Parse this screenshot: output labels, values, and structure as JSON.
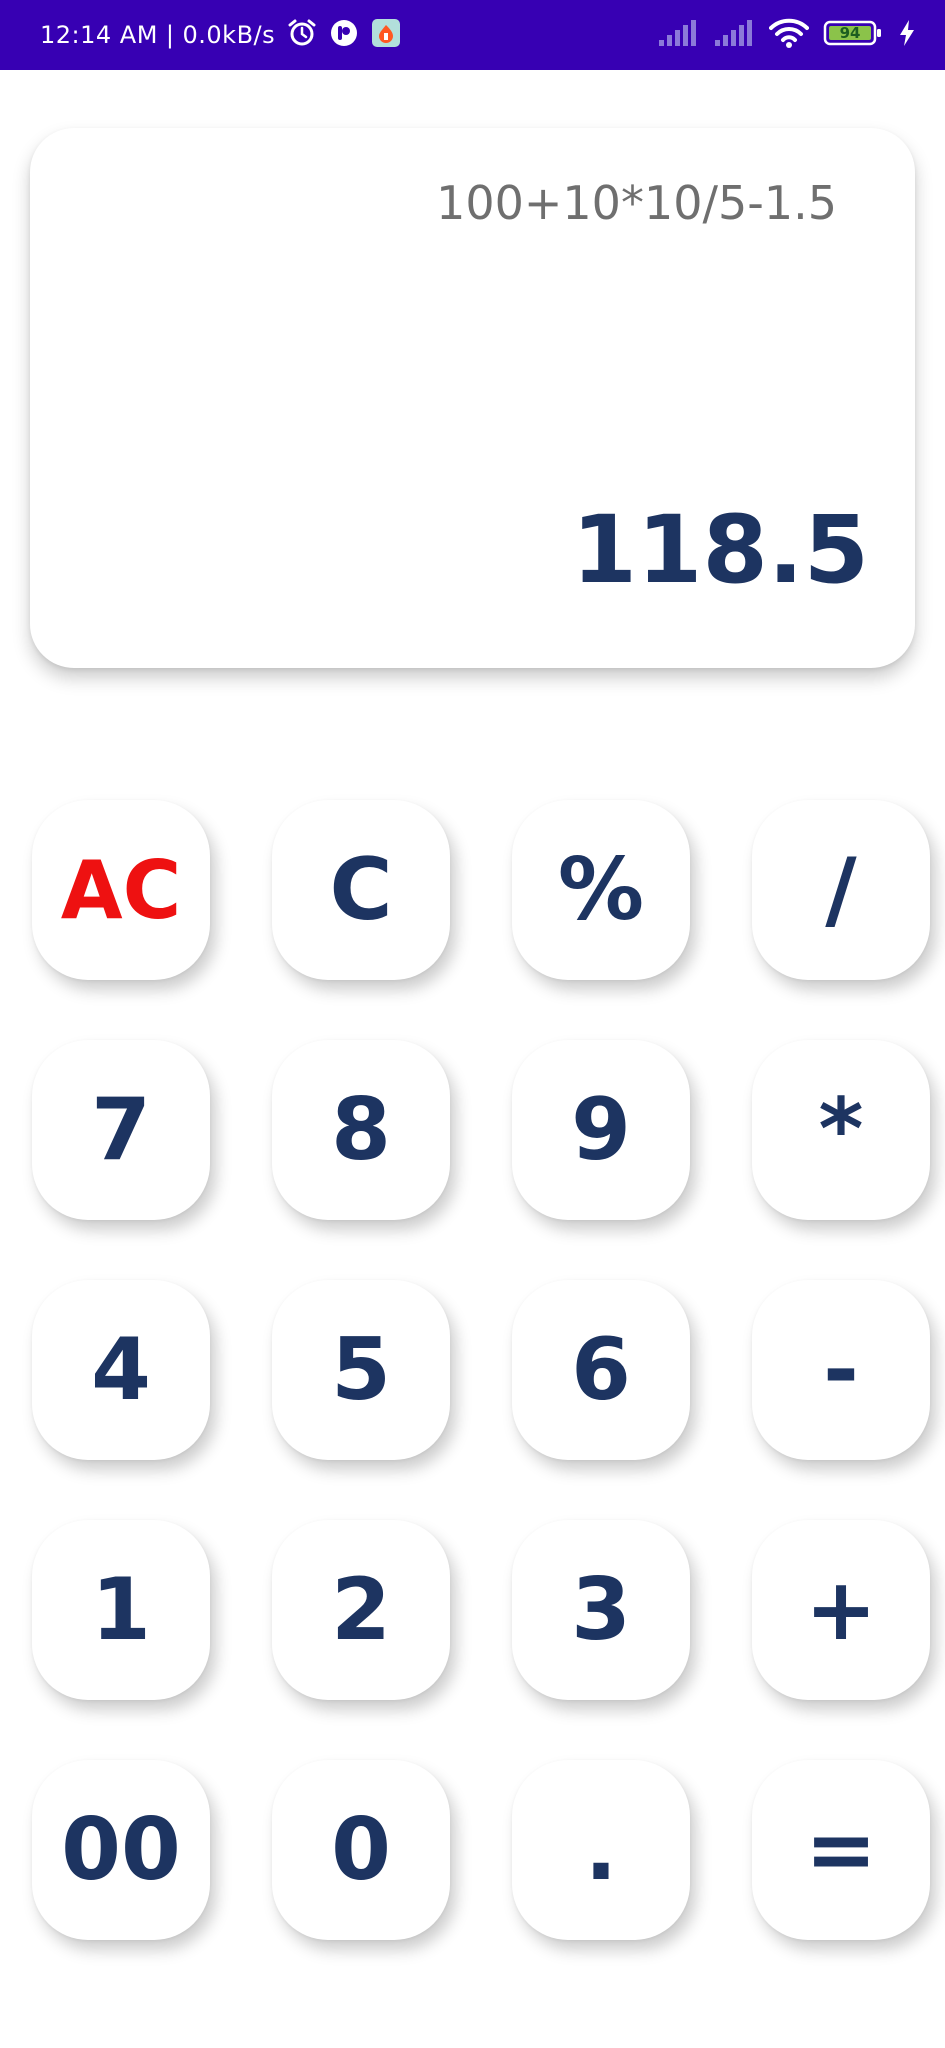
{
  "status_bar": {
    "time": "12:14 AM",
    "separator": "|",
    "speed": "0.0kB/s",
    "battery": "94",
    "icons": [
      "alarm-icon",
      "app-icon",
      "app-icon-orange",
      "signal-icon",
      "signal-icon",
      "wifi-icon",
      "battery-icon",
      "charging-icon"
    ]
  },
  "display": {
    "expression": "100+10*10/5-1.5",
    "result": "118.5"
  },
  "keys": {
    "ac": "AC",
    "c": "C",
    "percent": "%",
    "divide": "/",
    "seven": "7",
    "eight": "8",
    "nine": "9",
    "multiply": "*",
    "four": "4",
    "five": "5",
    "six": "6",
    "minus": "-",
    "one": "1",
    "two": "2",
    "three": "3",
    "plus": "+",
    "double_zero": "00",
    "zero": "0",
    "dot": ".",
    "equals": "="
  },
  "colors": {
    "status_bar": "#3700b3",
    "text": "#1d3461",
    "ac": "#ee1111",
    "expression": "#6f6f6f"
  }
}
